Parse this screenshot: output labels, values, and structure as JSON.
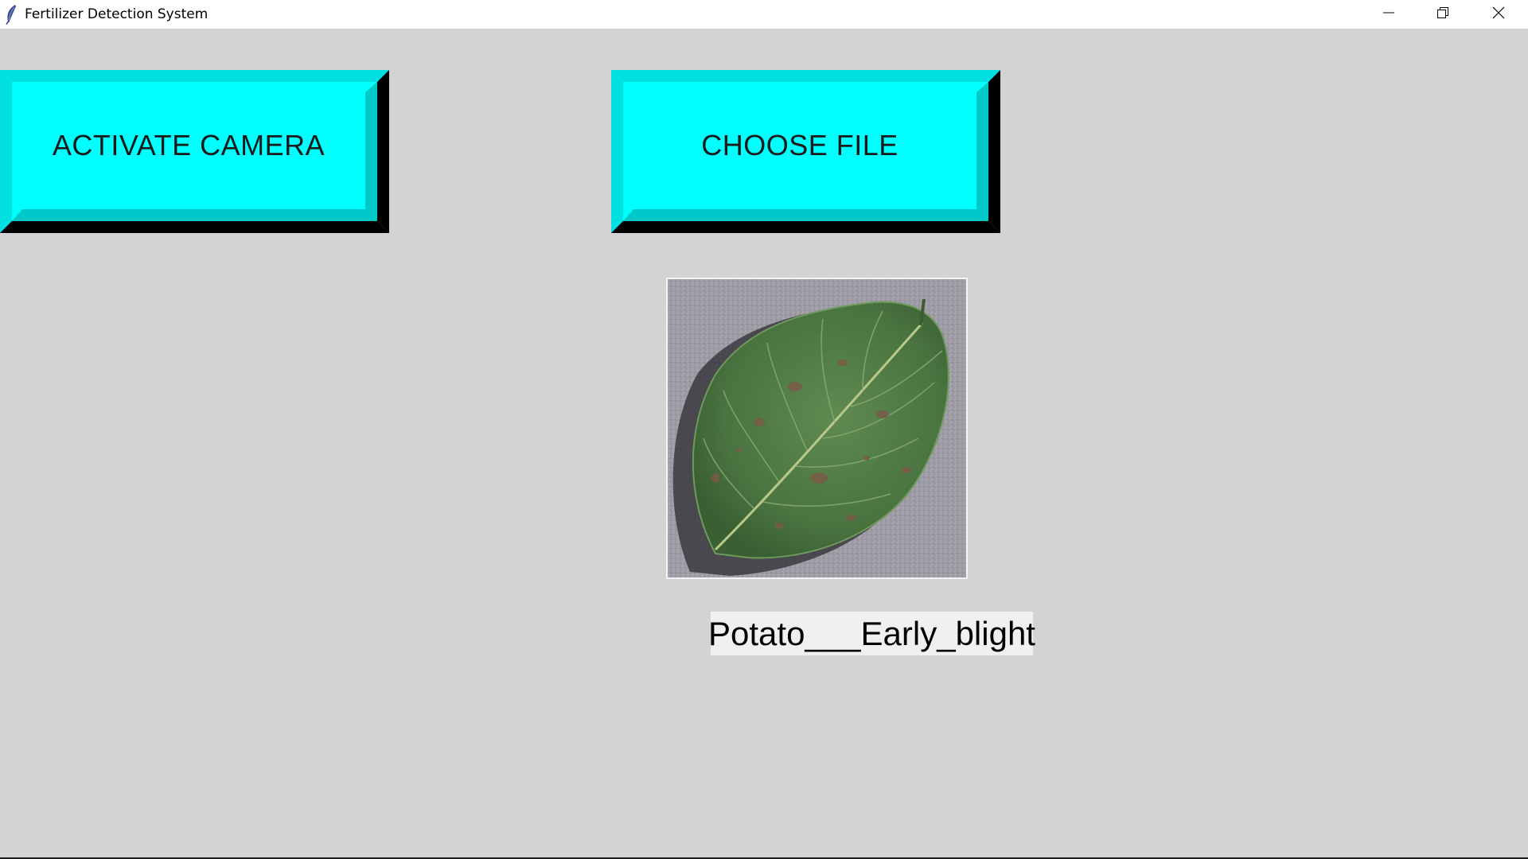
{
  "window": {
    "title": "Fertilizer Detection System",
    "controls": {
      "minimize_icon": "minimize-icon",
      "maximize_icon": "restore-icon",
      "close_icon": "close-icon"
    }
  },
  "buttons": {
    "activate_camera": "ACTIVATE CAMERA",
    "choose_file": "CHOOSE FILE"
  },
  "image": {
    "subject": "potato-leaf-image"
  },
  "result": {
    "label": "Potato___Early_blight"
  },
  "colors": {
    "button_face": "#00ffff",
    "button_highlight": "#00e0e0",
    "button_shadow": "#000000",
    "background": "#d3d3d3",
    "titlebar": "#ffffff"
  }
}
